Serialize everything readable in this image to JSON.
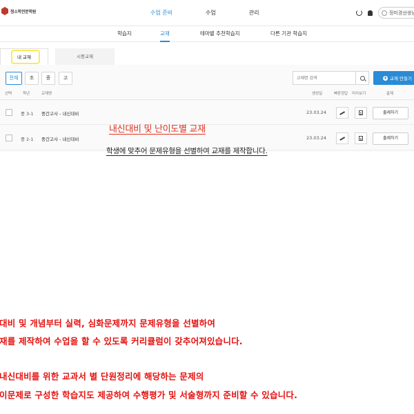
{
  "header": {
    "logo_text": "청소학전문학원",
    "nav": [
      {
        "label": "수업 준비",
        "active": true
      },
      {
        "label": "수업",
        "active": false
      },
      {
        "label": "관리",
        "active": false
      }
    ],
    "user_name": "정미경선생님"
  },
  "subnav": [
    {
      "label": "학습지",
      "active": false
    },
    {
      "label": "교재",
      "active": true
    },
    {
      "label": "테마별 추천학습지",
      "active": false
    },
    {
      "label": "다른 기관 학습지",
      "active": false
    }
  ],
  "tabs": {
    "my": "내 교재",
    "market": "시중교재"
  },
  "grade_filters": [
    "전체",
    "초",
    "중",
    "고"
  ],
  "search": {
    "placeholder": "교재명 검색",
    "make_label": "교재 만들기"
  },
  "table": {
    "headers": {
      "select": "선택",
      "grade": "학년",
      "name": "교재명",
      "created": "생성일",
      "quick_answer": "빠른정답",
      "preview": "미리보기",
      "issue": "출제"
    },
    "rows": [
      {
        "grade": "중 3-1",
        "name": "중간고사 - 내신대비",
        "date": "23.03.24",
        "issue_label": "출제하기"
      },
      {
        "grade": "중 2-1",
        "name": "중간고사 - 내신대비",
        "date": "23.03.24",
        "issue_label": "출제하기"
      }
    ]
  },
  "promo": {
    "title": "내신대비 및 난이도별 교재",
    "subtitle": "학생에 맞추어 문제유형을 선별하여 교재를 제작합니다."
  },
  "description": [
    "대비 및 개념부터 실력, 심화문제까지 문제유형을 선별하여",
    "재를 제작하여 수업을 할 수 있도록 커리큘럼이 갖추어져있습니다.",
    "내신대비를 위한 교과서 별 단원정리에 해당하는 문제의",
    "이문제로 구성한 학습지도 제공하여 수행평가 및 서술형까지 준비할 수 있습니다."
  ],
  "colors": {
    "accent": "#2a8bd6",
    "promo_red": "#e0301e",
    "highlight": "#f7ec5c"
  }
}
